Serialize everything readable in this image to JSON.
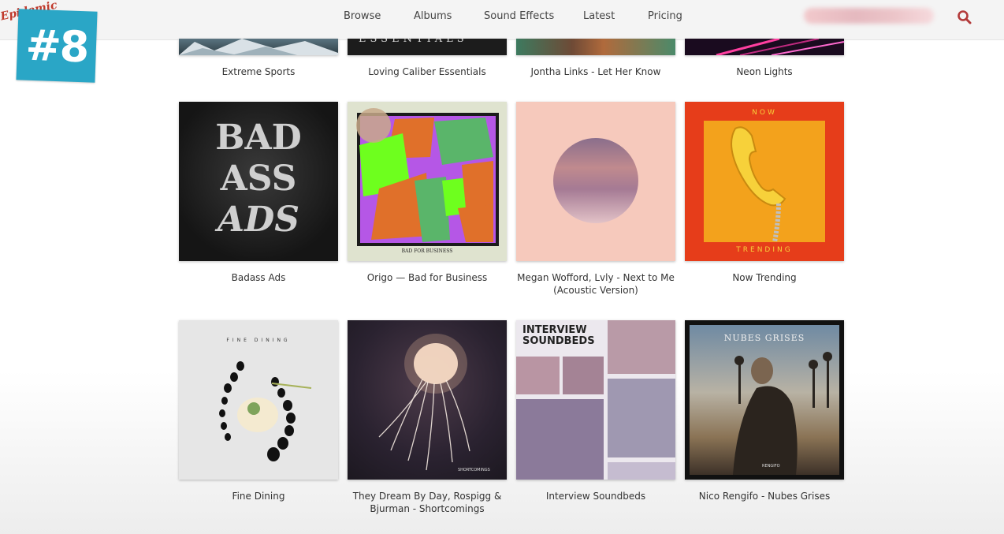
{
  "brand": {
    "logo_text": "Epidemic"
  },
  "nav": {
    "items": [
      "Browse",
      "Albums",
      "Sound Effects",
      "Latest",
      "Pricing"
    ]
  },
  "overlay_badge": "#8",
  "albums": {
    "row0": [
      "Extreme Sports",
      "Loving Caliber Essentials",
      "Jontha Links - Let Her Know",
      "Neon Lights"
    ],
    "row1": [
      "Badass Ads",
      "Origo — Bad for Business",
      "Megan Wofford, Lvly - Next to Me (Acoustic Version)",
      "Now Trending"
    ],
    "row2": [
      "Fine Dining",
      "They Dream By Day, Rospigg & Bjurman - Shortcomings",
      "Interview Soundbeds",
      "Nico Rengifo - Nubes Grises"
    ]
  },
  "cover_text": {
    "essentials": "ESSENTIALS",
    "badass_line1": "BAD",
    "badass_line2": "ASS",
    "badass_line3": "ADS",
    "origo_caption": "BAD FOR BUSINESS",
    "now": "NOW",
    "trending": "TRENDING",
    "fine_dining": "FINE DINING",
    "shortcomings": "SHORTCOMINGS",
    "interview_line1": "INTERVIEW",
    "interview_line2": "SOUNDBEDS",
    "nubes": "NUBES GRISES",
    "rengifo": "RENGIFO"
  }
}
